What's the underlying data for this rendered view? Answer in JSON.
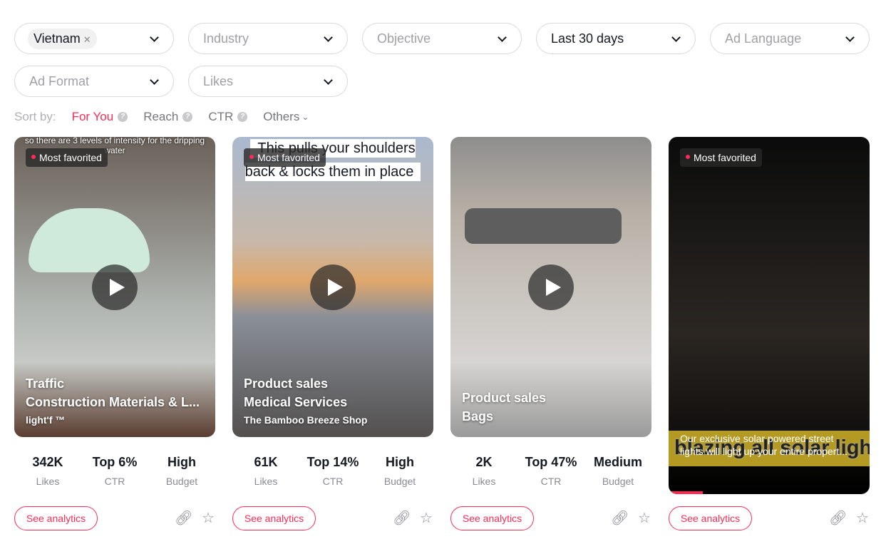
{
  "filters": [
    {
      "label": "Vietnam",
      "selected": true,
      "tag": true
    },
    {
      "label": "Industry",
      "selected": false
    },
    {
      "label": "Objective",
      "selected": false
    },
    {
      "label": "Last 30 days",
      "selected": true
    },
    {
      "label": "Ad Language",
      "selected": false
    },
    {
      "label": "Ad Format",
      "selected": false
    },
    {
      "label": "Likes",
      "selected": false
    }
  ],
  "sort": {
    "label": "Sort by:",
    "options": [
      "For You",
      "Reach",
      "CTR",
      "Others"
    ],
    "active": "For You"
  },
  "cards": [
    {
      "badge": "Most favorited",
      "objective": "Traffic",
      "industry": "Construction Materials & L...",
      "brand": "light'f ™",
      "caption": "so there are 3 levels of intensity for the dripping water",
      "likes": "342K",
      "likes_label": "Likes",
      "ctr": "Top 6%",
      "ctr_label": "CTR",
      "budget": "High",
      "budget_label": "Budget",
      "analytics": "See analytics"
    },
    {
      "badge": "Most favorited",
      "objective": "Product sales",
      "industry": "Medical Services",
      "brand": "The Bamboo Breeze Shop",
      "caption": "This pulls your shoulders back & locks them in place",
      "likes": "61K",
      "likes_label": "Likes",
      "ctr": "Top 14%",
      "ctr_label": "CTR",
      "budget": "High",
      "budget_label": "Budget",
      "analytics": "See analytics"
    },
    {
      "objective": "Product sales",
      "industry": "Bags",
      "likes": "2K",
      "likes_label": "Likes",
      "ctr": "Top 47%",
      "ctr_label": "CTR",
      "budget": "Medium",
      "budget_label": "Budget",
      "analytics": "See analytics"
    },
    {
      "badge": "Most favorited",
      "caption_big": "blazing all solar light",
      "caption": "Our exclusive solar powered street lights will light up your entire propert...",
      "progress": 0.17,
      "analytics": "See analytics"
    }
  ],
  "colors": {
    "accent": "#fe2c55"
  }
}
